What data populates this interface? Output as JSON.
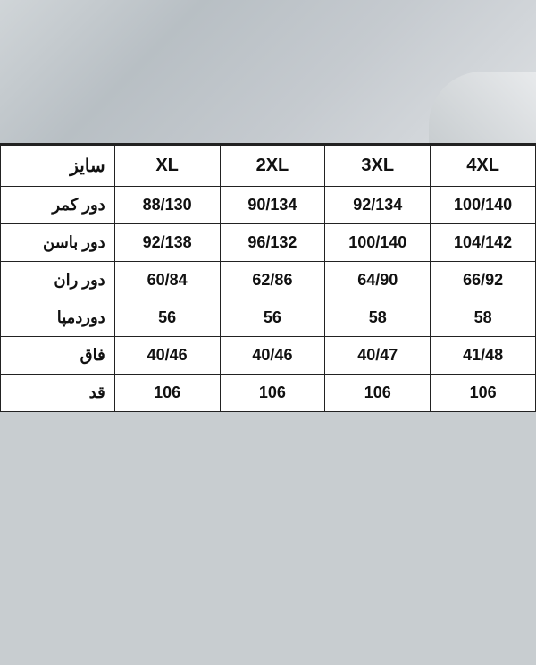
{
  "topArea": {
    "bgDescription": "textured light gray background photo"
  },
  "table": {
    "headers": [
      {
        "id": "col-4xl",
        "label": "4XL"
      },
      {
        "id": "col-3xl",
        "label": "3XL"
      },
      {
        "id": "col-2xl",
        "label": "2XL"
      },
      {
        "id": "col-xl",
        "label": "XL"
      },
      {
        "id": "col-size",
        "label": "سایز"
      }
    ],
    "rows": [
      {
        "id": "row-kamar",
        "label": "دور کمر",
        "values": [
          "100/140",
          "92/134",
          "90/134",
          "88/130"
        ]
      },
      {
        "id": "row-basin",
        "label": "دور باسن",
        "values": [
          "104/142",
          "100/140",
          "96/132",
          "92/138"
        ]
      },
      {
        "id": "row-ran",
        "label": "دور ران",
        "values": [
          "66/92",
          "64/90",
          "62/86",
          "60/84"
        ]
      },
      {
        "id": "row-dordampa",
        "label": "دوردمپا",
        "values": [
          "58",
          "58",
          "56",
          "56"
        ]
      },
      {
        "id": "row-faq",
        "label": "فاق",
        "values": [
          "41/48",
          "40/47",
          "40/46",
          "40/46"
        ]
      },
      {
        "id": "row-qad",
        "label": "قد",
        "values": [
          "106",
          "106",
          "106",
          "106"
        ]
      }
    ]
  }
}
